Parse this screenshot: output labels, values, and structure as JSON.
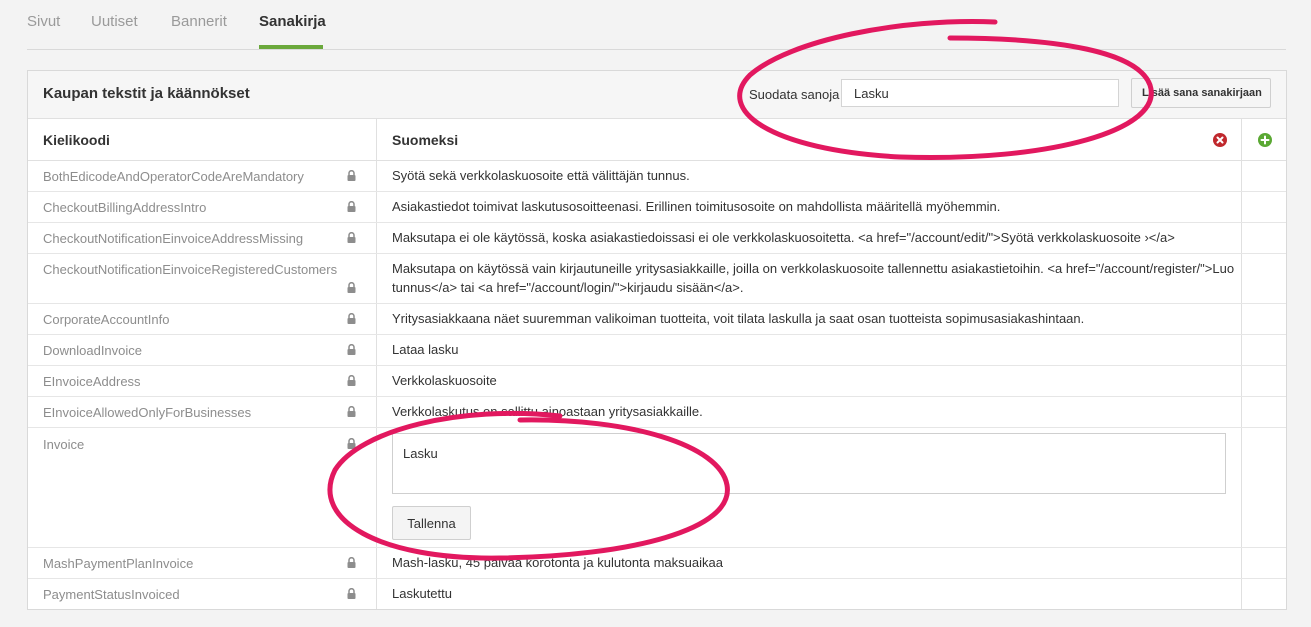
{
  "tabs": [
    {
      "label": "Sivut"
    },
    {
      "label": "Uutiset"
    },
    {
      "label": "Bannerit"
    },
    {
      "label": "Sanakirja",
      "active": true
    }
  ],
  "panel": {
    "title": "Kaupan tekstit ja käännökset",
    "filter_label": "Suodata sanoja",
    "filter_value": "Lasku",
    "add_word_label": "Lisää sana sanakirjaan"
  },
  "table": {
    "headers": [
      "Kielikoodi",
      "Suomeksi"
    ],
    "rows": [
      {
        "key": "BothEdicodeAndOperatorCodeAreMandatory",
        "value": "Syötä sekä verkkolaskuosoite että välittäjän tunnus."
      },
      {
        "key": "CheckoutBillingAddressIntro",
        "value": "Asiakastiedot toimivat laskutusosoitteenasi. Erillinen toimitusosoite on mahdollista määritellä myöhemmin."
      },
      {
        "key": "CheckoutNotificationEinvoiceAddressMissing",
        "value": "Maksutapa ei ole käytössä, koska asiakastiedoissasi ei ole verkkolaskuosoitetta. <a href=\"/account/edit/\">Syötä verkkolaskuosoite ›</a>"
      },
      {
        "key": "CheckoutNotificationEinvoiceRegisteredCustomers",
        "value": "Maksutapa on käytössä vain kirjautuneille yritysasiakkaille, joilla on verkkolaskuosoite tallennettu asiakastietoihin. <a href=\"/account/register/\">Luo tunnus</a> tai <a href=\"/account/login/\">kirjaudu sisään</a>."
      },
      {
        "key": "CorporateAccountInfo",
        "value": "Yritysasiakkaana näet suuremman valikoiman tuotteita, voit tilata laskulla ja saat osan tuotteista sopimusasiakashintaan."
      },
      {
        "key": "DownloadInvoice",
        "value": "Lataa lasku"
      },
      {
        "key": "EInvoiceAddress",
        "value": "Verkkolaskuosoite"
      },
      {
        "key": "EInvoiceAllowedOnlyForBusinesses",
        "value": "Verkkolaskutus on sallittu ainoastaan yritysasiakkaille."
      },
      {
        "key": "Invoice",
        "value": "Lasku",
        "editing": true
      },
      {
        "key": "MashPaymentPlanInvoice",
        "value": "Mash-lasku, 45 päivää korotonta ja kulutonta maksuaikaa"
      },
      {
        "key": "PaymentStatusInvoiced",
        "value": "Laskutettu"
      }
    ],
    "save_label": "Tallenna"
  },
  "icons": {
    "lock": "lock-icon",
    "remove": "remove-language-icon",
    "add": "add-language-icon"
  },
  "colors": {
    "accent_green": "#6aa83b",
    "remove_red": "#c0282d",
    "annotation_pink": "#e2185f"
  }
}
